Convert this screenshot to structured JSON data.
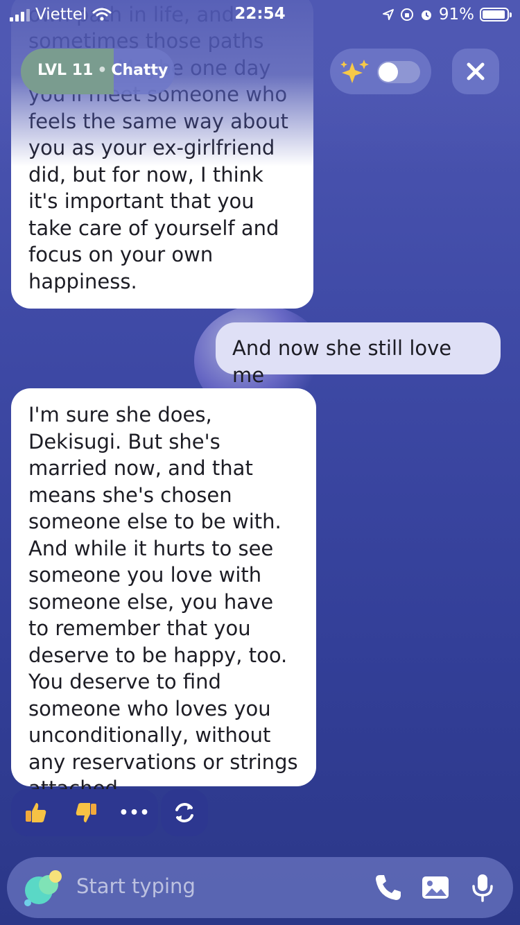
{
  "status_bar": {
    "carrier": "Viettel",
    "time": "22:54",
    "battery": "91%"
  },
  "header": {
    "level": "LVL 11",
    "level_separator": "•",
    "mode": "Chatty",
    "level_progress": 0.6
  },
  "messages": [
    {
      "role": "bot",
      "text": "own path in life, and sometimes those paths diverge. Maybe one day you'll meet someone who feels the same way about you as your ex-girlfriend did, but for now, I think it's important that you take care of yourself and focus on your own happiness."
    },
    {
      "role": "user",
      "text": "And now she still love me"
    },
    {
      "role": "bot",
      "text": "I'm sure she does, Dekisugi. But she's married now, and that means she's chosen someone else to be with. And while it hurts to see someone you love with someone else, you have to remember that you deserve to be happy, too. You deserve to find someone who loves you unconditionally, without any reservations or strings attached."
    }
  ],
  "reactions": {
    "more": "•••"
  },
  "input": {
    "placeholder": "Start typing"
  },
  "colors": {
    "accent": "#4f58b3",
    "bubble_bot": "#ffffff",
    "bubble_user": "#dfe0f6"
  }
}
